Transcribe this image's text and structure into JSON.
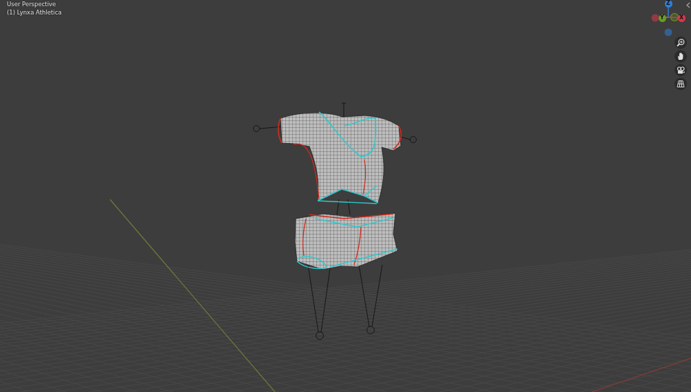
{
  "viewport": {
    "view_name": "User Perspective",
    "object_label": "(1) Lynxa Athletica"
  },
  "gizmo": {
    "axes": [
      {
        "label": "Z",
        "color": "#2e7fd8"
      },
      {
        "label": "Y",
        "color": "#6b9b23"
      },
      {
        "label": "X",
        "color": "#d8374e"
      }
    ]
  }
}
